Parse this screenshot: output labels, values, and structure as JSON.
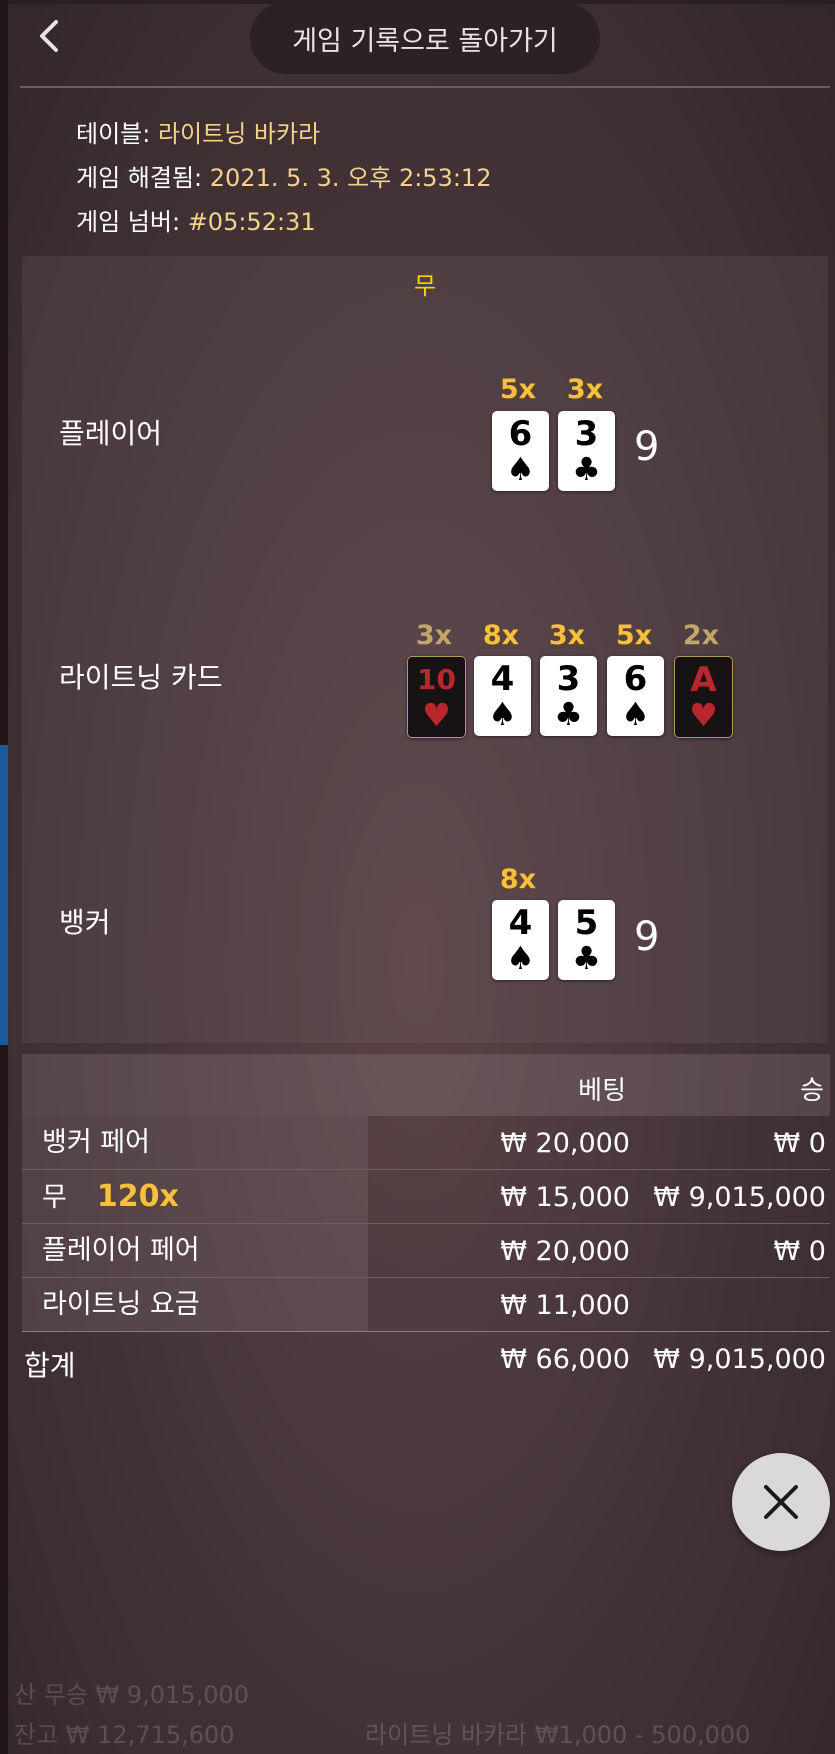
{
  "header": {
    "back_label": "게임 기록으로 돌아가기"
  },
  "info": {
    "table_label": "테이블:",
    "table_value": "라이트닝 바카라",
    "resolved_label": "게임 해결됨:",
    "resolved_value": "2021. 5. 3. 오후 2:53:12",
    "game_no_label": "게임 넘버:",
    "game_no_value": "#05:52:31"
  },
  "result": {
    "outcome": "무",
    "player": {
      "label": "플레이어",
      "total": "9",
      "cards": [
        {
          "rank": "6",
          "suit": "♠",
          "multiplier": "5x"
        },
        {
          "rank": "3",
          "suit": "♣",
          "multiplier": "3x"
        }
      ]
    },
    "lightning": {
      "label": "라이트닝 카드",
      "cards": [
        {
          "rank": "10",
          "suit": "♥",
          "multiplier": "3x"
        },
        {
          "rank": "4",
          "suit": "♠",
          "multiplier": "8x"
        },
        {
          "rank": "3",
          "suit": "♣",
          "multiplier": "3x"
        },
        {
          "rank": "6",
          "suit": "♠",
          "multiplier": "5x"
        },
        {
          "rank": "A",
          "suit": "♥",
          "multiplier": "2x"
        }
      ]
    },
    "banker": {
      "label": "뱅커",
      "total": "9",
      "cards": [
        {
          "rank": "4",
          "suit": "♠",
          "multiplier": "8x"
        },
        {
          "rank": "5",
          "suit": "♣",
          "multiplier": ""
        }
      ]
    }
  },
  "bets_table": {
    "col_bet": "베팅",
    "col_win": "승",
    "rows": [
      {
        "name": "뱅커 페어",
        "multiplier": "",
        "bet": "₩ 20,000",
        "win": "₩ 0"
      },
      {
        "name": "무",
        "multiplier": "120x",
        "bet": "₩ 15,000",
        "win": "₩ 9,015,000"
      },
      {
        "name": "플레이어 페어",
        "multiplier": "",
        "bet": "₩ 20,000",
        "win": "₩ 0"
      },
      {
        "name": "라이트닝 요금",
        "multiplier": "",
        "bet": "₩ 11,000",
        "win": ""
      }
    ],
    "total": {
      "name": "합계",
      "bet": "₩ 66,000",
      "win": "₩ 9,015,000"
    }
  },
  "background_ghost": {
    "line1": "산 무승 ₩ 9,015,000",
    "line2": "잔고 ₩ 12,715,600",
    "line3": "라이트닝 바카라 ₩1,000 - 500,000"
  },
  "colors": {
    "gold": "#f7c040",
    "outcome_yellow": "#ffd000",
    "info_value": "#f3d28a"
  }
}
